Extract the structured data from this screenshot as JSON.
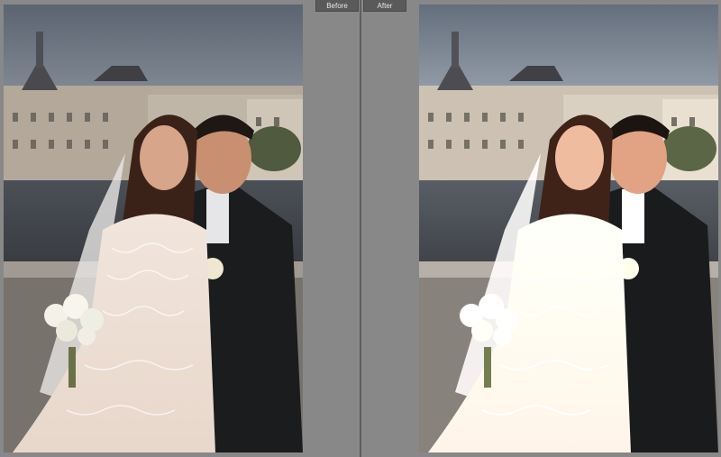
{
  "labels": {
    "before": "Before",
    "after": "After"
  },
  "colors": {
    "background": "#888888",
    "divider": "#5e5e5e",
    "tab_background": "#5a5a5a",
    "tab_text": "#e6e6e6"
  },
  "images": {
    "before_icon": "wedding-photo-before",
    "after_icon": "wedding-photo-after"
  }
}
